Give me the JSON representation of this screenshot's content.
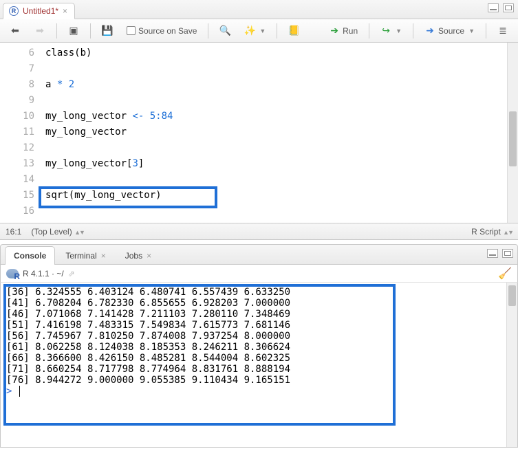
{
  "tab": {
    "title": "Untitled1*"
  },
  "toolbar": {
    "source_on_save": "Source on Save",
    "run": "Run",
    "source": "Source"
  },
  "code_lines": [
    {
      "n": 6,
      "html": "class(b)"
    },
    {
      "n": 7,
      "html": ""
    },
    {
      "n": 8,
      "html": "a <span class=\"kw-op\">*</span> <span class=\"kw-num\">2</span>"
    },
    {
      "n": 9,
      "html": ""
    },
    {
      "n": 10,
      "html": "my_long_vector <span class=\"kw-op\">&lt;-</span> <span class=\"kw-num\">5</span><span class=\"kw-op\">:</span><span class=\"kw-num\">84</span>"
    },
    {
      "n": 11,
      "html": "my_long_vector"
    },
    {
      "n": 12,
      "html": ""
    },
    {
      "n": 13,
      "html": "my_long_vector[<span class=\"kw-num\">3</span>]"
    },
    {
      "n": 14,
      "html": ""
    },
    {
      "n": 15,
      "html": "sqrt(my_long_vector)"
    },
    {
      "n": 16,
      "html": ""
    }
  ],
  "status": {
    "pos": "16:1",
    "scope": "(Top Level)",
    "lang": "R Script"
  },
  "console_tabs": {
    "console": "Console",
    "terminal": "Terminal",
    "jobs": "Jobs"
  },
  "console_sub": {
    "version": "R 4.1.1 · ~/"
  },
  "console_output": [
    "[36] 6.324555 6.403124 6.480741 6.557439 6.633250",
    "[41] 6.708204 6.782330 6.855655 6.928203 7.000000",
    "[46] 7.071068 7.141428 7.211103 7.280110 7.348469",
    "[51] 7.416198 7.483315 7.549834 7.615773 7.681146",
    "[56] 7.745967 7.810250 7.874008 7.937254 8.000000",
    "[61] 8.062258 8.124038 8.185353 8.246211 8.306624",
    "[66] 8.366600 8.426150 8.485281 8.544004 8.602325",
    "[71] 8.660254 8.717798 8.774964 8.831761 8.888194",
    "[76] 8.944272 9.000000 9.055385 9.110434 9.165151"
  ],
  "prompt": ">"
}
